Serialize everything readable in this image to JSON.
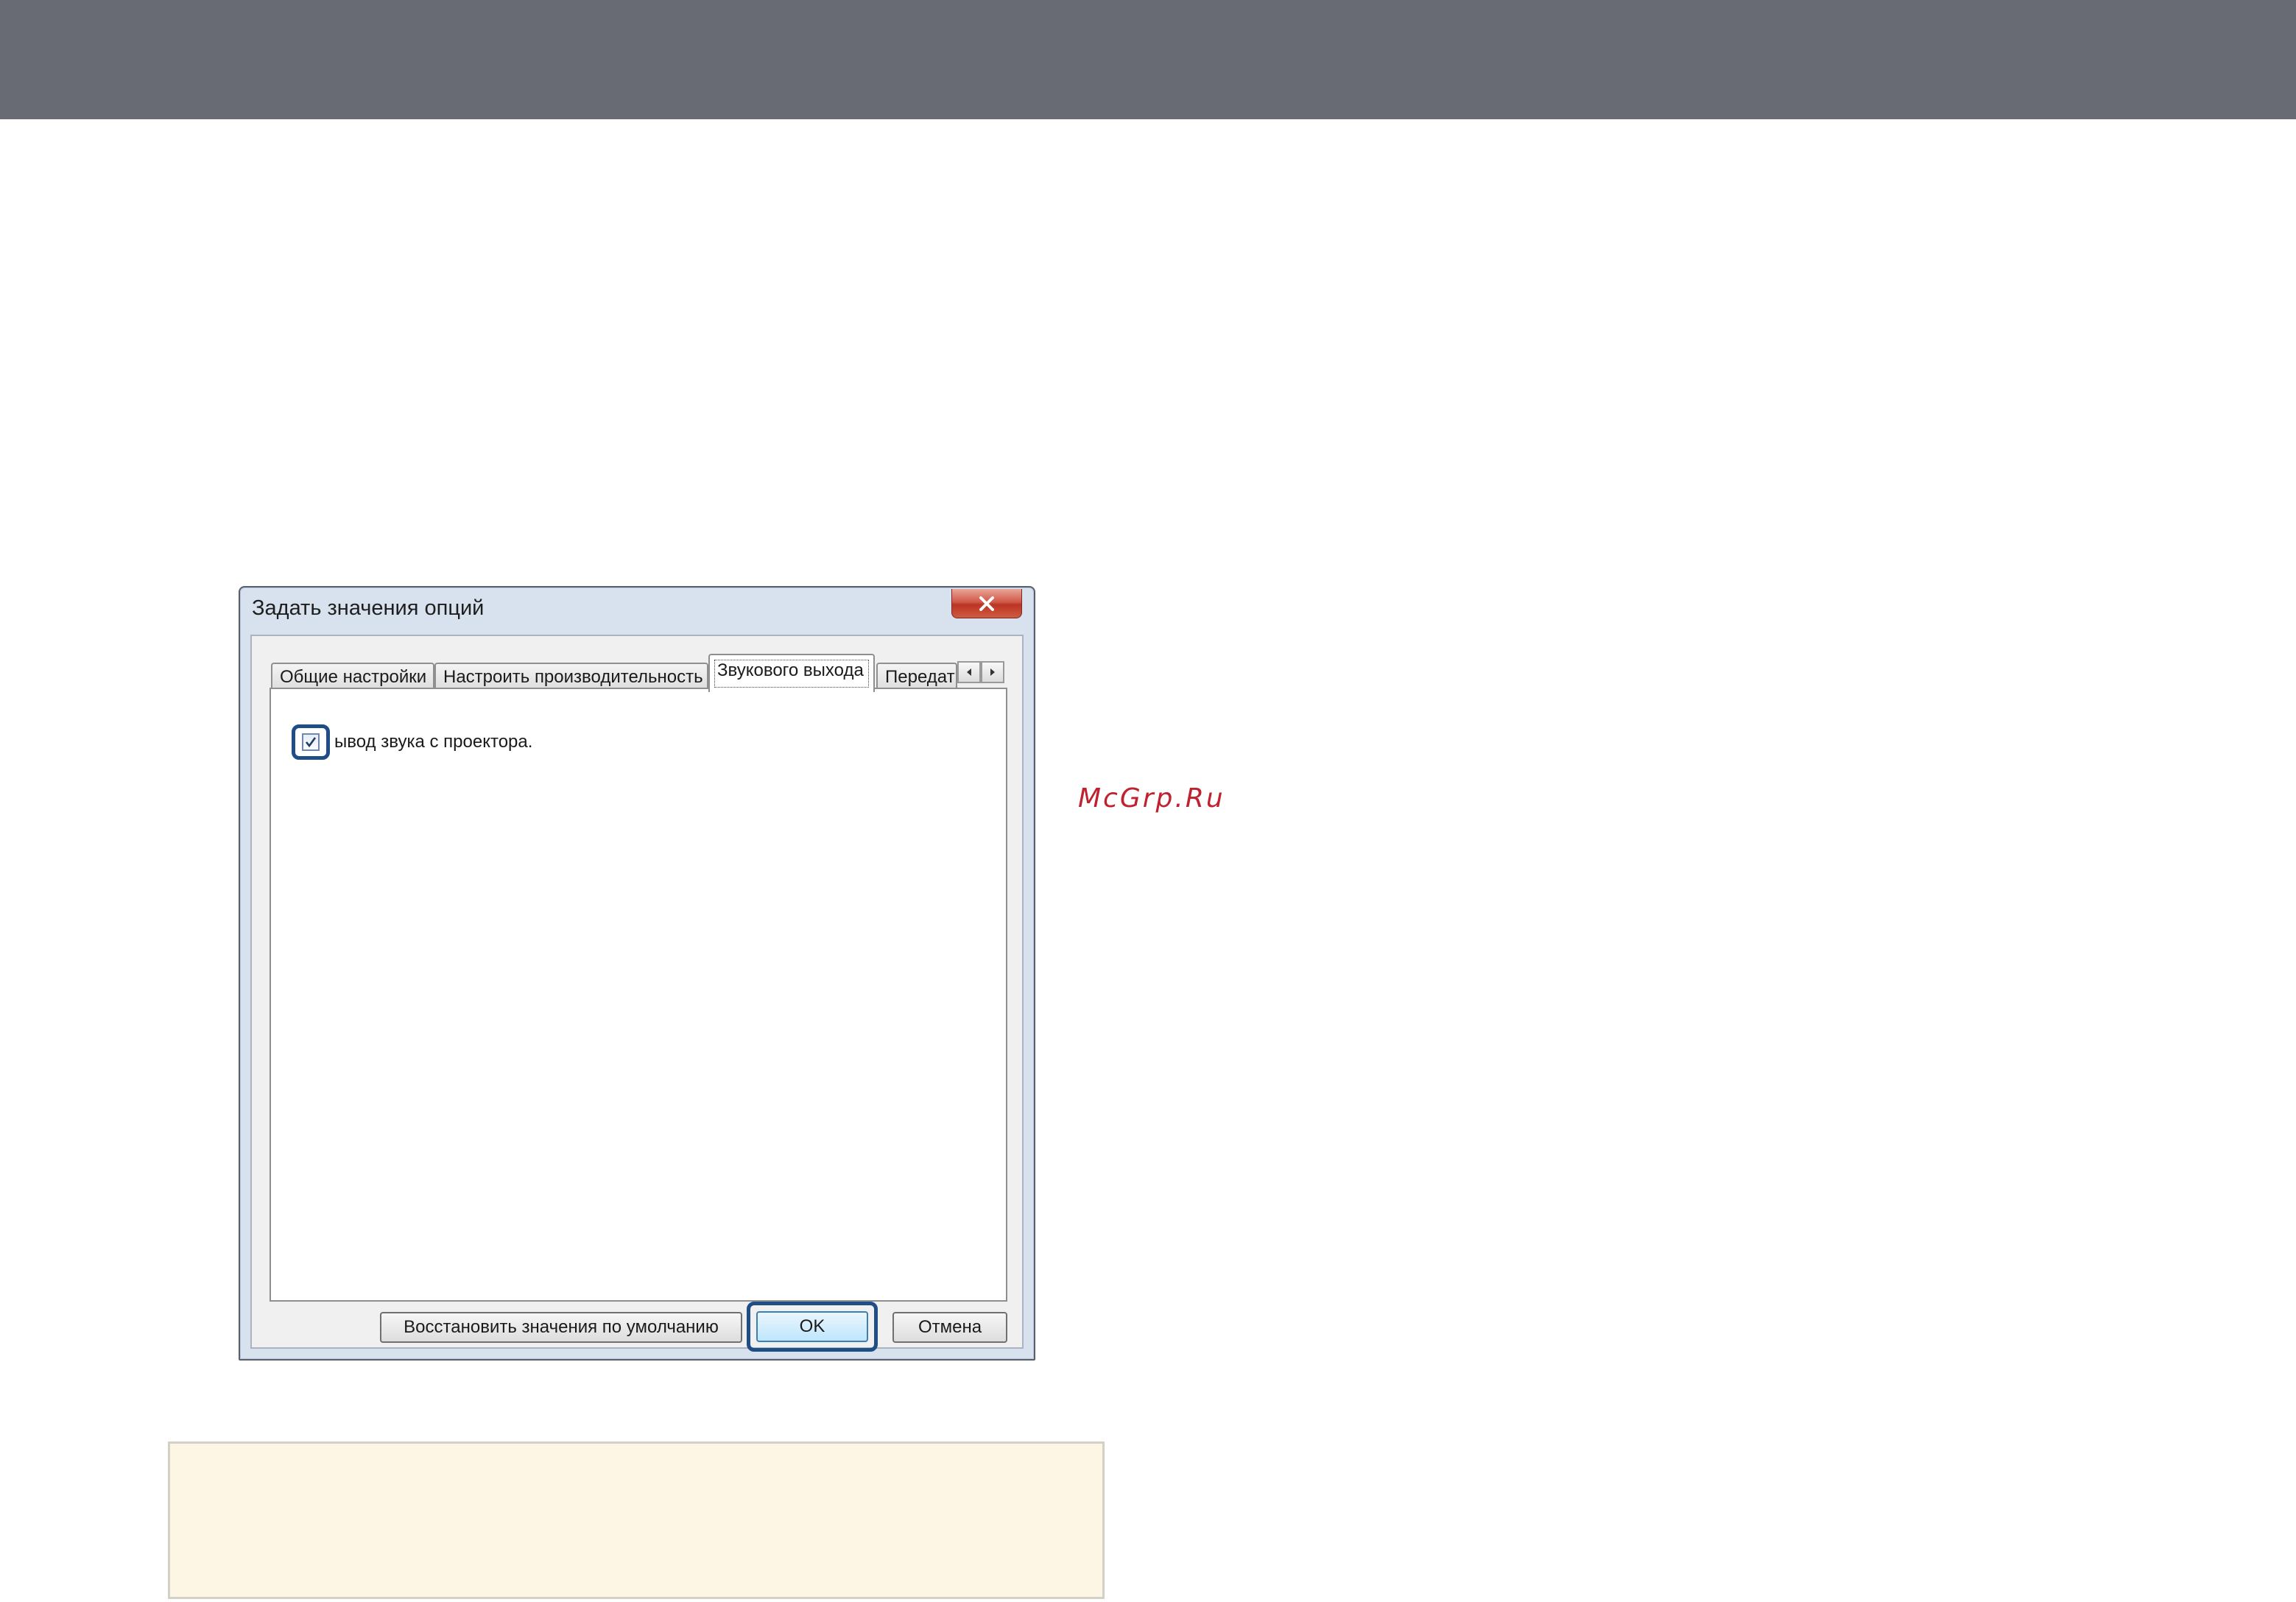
{
  "dialog": {
    "title": "Задать значения опций",
    "close_icon": "close-icon",
    "tabs": [
      {
        "label": "Общие настройки",
        "active": false
      },
      {
        "label": "Настроить производительность",
        "active": false
      },
      {
        "label": "Звукового выхода",
        "active": true
      },
      {
        "label": "Передать",
        "active": false
      }
    ],
    "tab_scroll_icons": [
      "chevron-left-icon",
      "chevron-right-icon"
    ],
    "audio_output": {
      "checked": true,
      "label": "ывод звука с проектора."
    },
    "buttons": {
      "restore": "Восстановить значения по умолчанию",
      "ok": "OK",
      "cancel": "Отмена"
    }
  },
  "watermark": "McGrp.Ru",
  "colors": {
    "header_bar": "#686b74",
    "highlight": "#1f4d86",
    "watermark": "#c0212f",
    "note_box": "#fdf6e4"
  }
}
